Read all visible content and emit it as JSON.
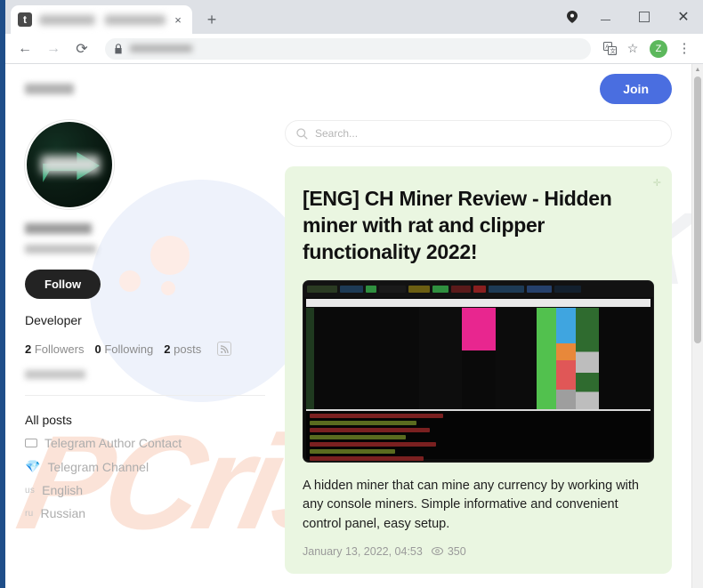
{
  "browser": {
    "tab": {
      "title_blurred": true,
      "favicon_letter": "t",
      "close_label": "×"
    },
    "new_tab_label": "+",
    "window_controls": {
      "minimize": "",
      "maximize": "",
      "close": "✕"
    },
    "toolbar": {
      "back": "←",
      "forward": "→",
      "reload": "⟳",
      "url_blurred": true,
      "translate": "文",
      "bookmark": "☆",
      "profile_initial": "Z",
      "menu": "⋮"
    }
  },
  "page": {
    "site_title_blurred": true,
    "join_label": "Join",
    "search": {
      "placeholder": "Search..."
    },
    "profile": {
      "name_blurred": true,
      "handle_blurred": true,
      "follow_label": "Follow",
      "bio": "Developer",
      "email_blurred": true,
      "stats": [
        {
          "num": "2",
          "label": "Followers"
        },
        {
          "num": "0",
          "label": "Following"
        },
        {
          "num": "2",
          "label": "posts"
        }
      ],
      "rss_icon": "rss-icon"
    },
    "nav": [
      {
        "label": "All posts",
        "icon": "",
        "cc": "",
        "state": "active"
      },
      {
        "label": "Telegram Author Contact",
        "icon": "envelope-icon",
        "cc": "",
        "state": "muted"
      },
      {
        "label": "Telegram Channel",
        "icon": "💎",
        "cc": "",
        "state": "muted"
      },
      {
        "label": "English",
        "icon": "",
        "cc": "us",
        "state": "muted"
      },
      {
        "label": "Russian",
        "icon": "",
        "cc": "ru",
        "state": "muted"
      }
    ],
    "post": {
      "title": "[ENG] CH Miner Review - Hidden miner with rat and clipper functionality 2022!",
      "description": "A hidden miner that can mine any currency by working with any console miners. Simple informative and convenient control panel, easy setup.",
      "date": "January 13, 2022, 04:53",
      "views": "350",
      "views_icon": "eye-icon",
      "pin_icon": "pin-icon",
      "card_color": "#eaf6e1",
      "thumbnail_alt": "dark mining control panel dashboard screenshot"
    },
    "watermark": {
      "text": "PCrisk",
      "text2": "PCrisk"
    }
  }
}
